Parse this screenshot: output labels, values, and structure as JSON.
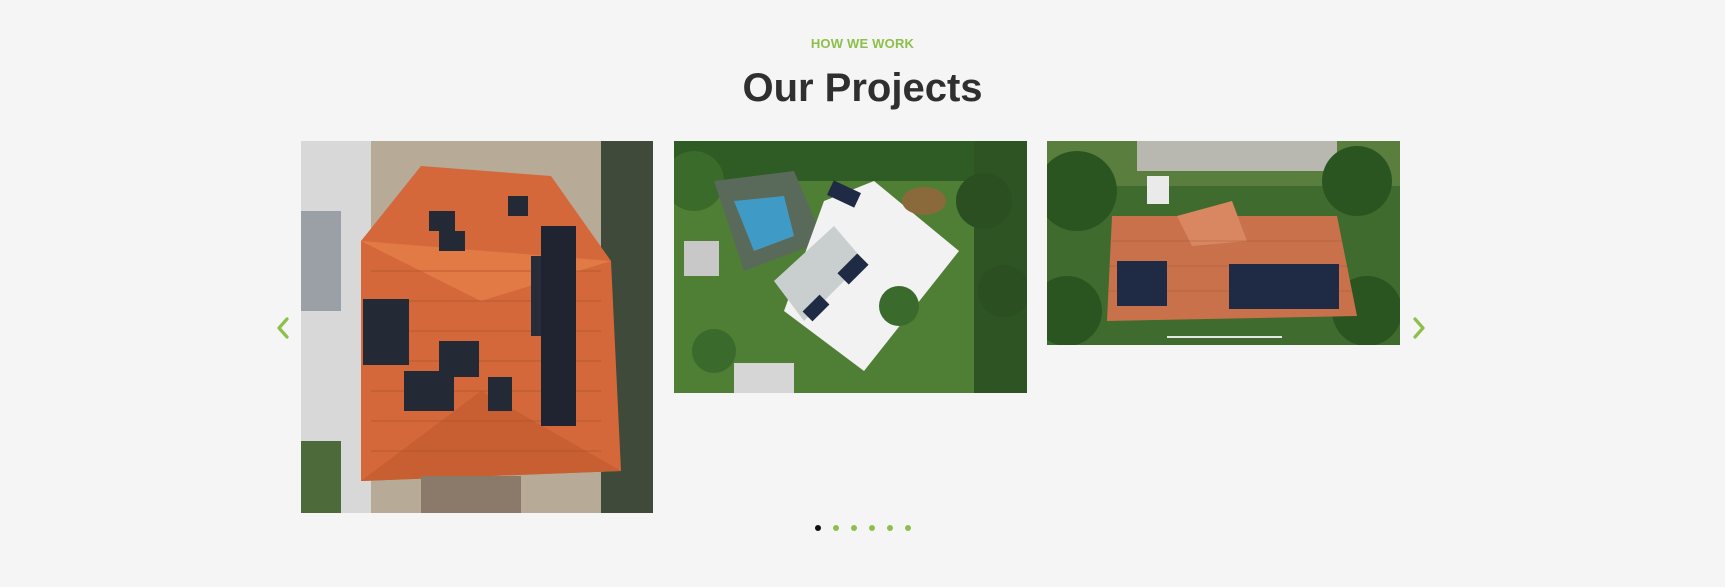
{
  "section": {
    "eyebrow": "HOW WE WORK",
    "title": "Our Projects"
  },
  "carousel": {
    "slides": [
      {
        "icon": "aerial-photo-terracotta-roof-solar"
      },
      {
        "icon": "aerial-photo-white-roof-solar-pool"
      },
      {
        "icon": "aerial-photo-roof-solar-trees"
      }
    ],
    "prev_icon": "chevron-left-icon",
    "next_icon": "chevron-right-icon",
    "dot_count": 6,
    "active_dot": 1
  },
  "colors": {
    "accent": "#8cc04a",
    "title": "#2f2f2f",
    "background": "#f5f5f5",
    "active_dot": "#111111"
  }
}
